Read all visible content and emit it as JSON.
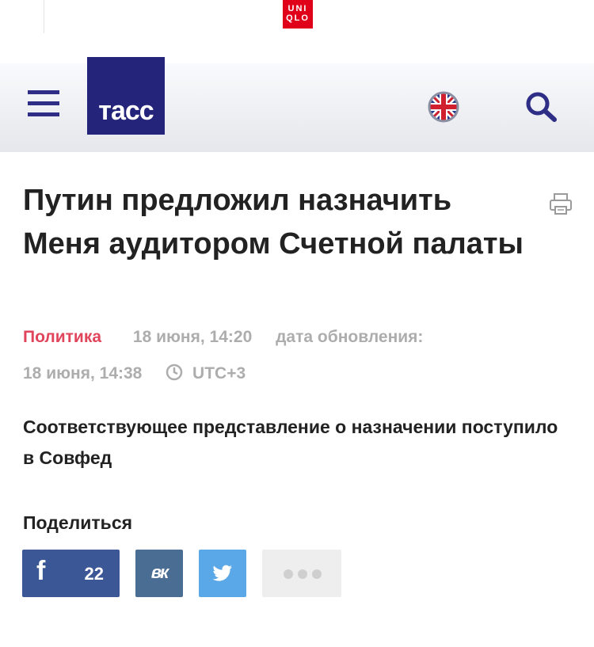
{
  "ad": {
    "brand_line1": "UNI",
    "brand_line2": "QLO",
    "brand_color": "#e1001a"
  },
  "header": {
    "menu_icon": "hamburger-icon",
    "logo_text": "тасс",
    "logo_color": "#24247a",
    "language_icon": "uk-flag-icon",
    "search_icon": "search-icon",
    "accent_color": "#2e2e86"
  },
  "article": {
    "headline": "Путин предложил назначить Меня аудитором Счетной палаты",
    "category": "Политика",
    "category_color": "#e0455c",
    "published": "18 июня, 14:20",
    "updated_label": "дата обновления:",
    "updated": "18 июня, 14:38",
    "timezone": "UTC+3",
    "lead": "Соответствующее представление о назначении поступило в Совфед",
    "print_icon": "printer-icon"
  },
  "share": {
    "title": "Поделиться",
    "facebook": {
      "icon": "facebook-icon",
      "label": "f",
      "count": "22",
      "color": "#3b5795"
    },
    "vk": {
      "icon": "vk-icon",
      "label": "вк",
      "color": "#4a6d94"
    },
    "twitter": {
      "icon": "twitter-icon",
      "color": "#5aa8e8"
    },
    "more": {
      "icon": "more-dots-icon",
      "color": "#eeeeee"
    }
  }
}
